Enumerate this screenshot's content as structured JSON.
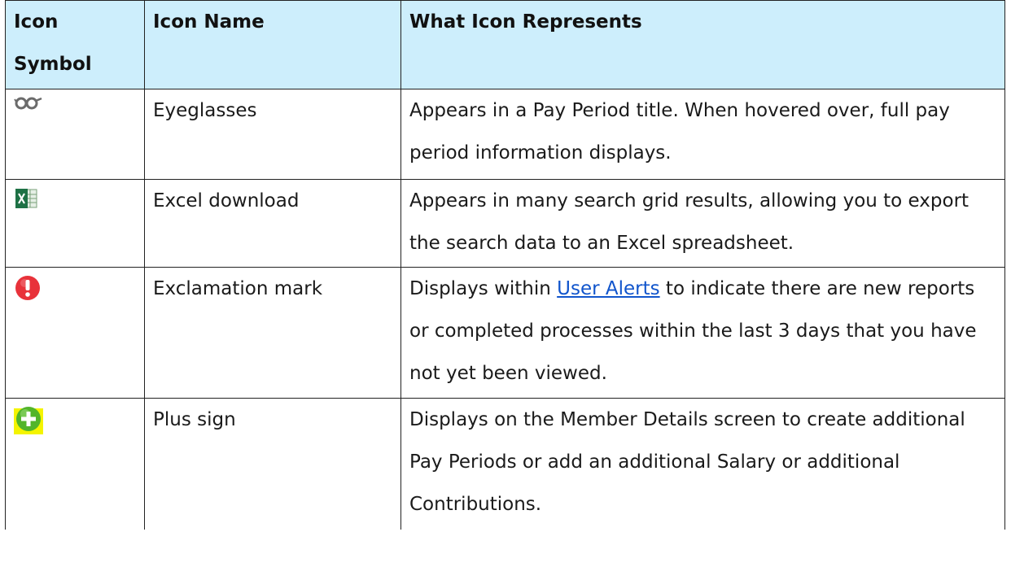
{
  "headers": {
    "icon_symbol": "Icon Symbol",
    "icon_name": "Icon Name",
    "what_icon_represents": "What Icon Represents"
  },
  "rows": [
    {
      "icon": "eyeglasses-icon",
      "name": "Eyeglasses",
      "description": "Appears in a Pay Period title. When hovered over, full pay period information displays."
    },
    {
      "icon": "excel-icon",
      "name": "Excel download",
      "description": "Appears in many search grid results, allowing you to export the search data to an Excel spreadsheet."
    },
    {
      "icon": "exclamation-icon",
      "name": "Exclamation mark",
      "description_before": "Displays within ",
      "link_text": "User Alerts",
      "description_after": " to indicate there are new reports or completed processes within the last 3 days that you have not yet been viewed."
    },
    {
      "icon": "plus-icon",
      "name": "Plus sign",
      "description": "Displays on the Member Details screen to create additional Pay Periods or add an additional Salary or additional Contributions."
    }
  ],
  "colors": {
    "header_background": "#cdeefc",
    "link": "#1155cc",
    "excel_green": "#1e7145",
    "exclamation_red": "#e8323a",
    "plus_green": "#52b52a",
    "plus_highlight": "#f4f400"
  }
}
